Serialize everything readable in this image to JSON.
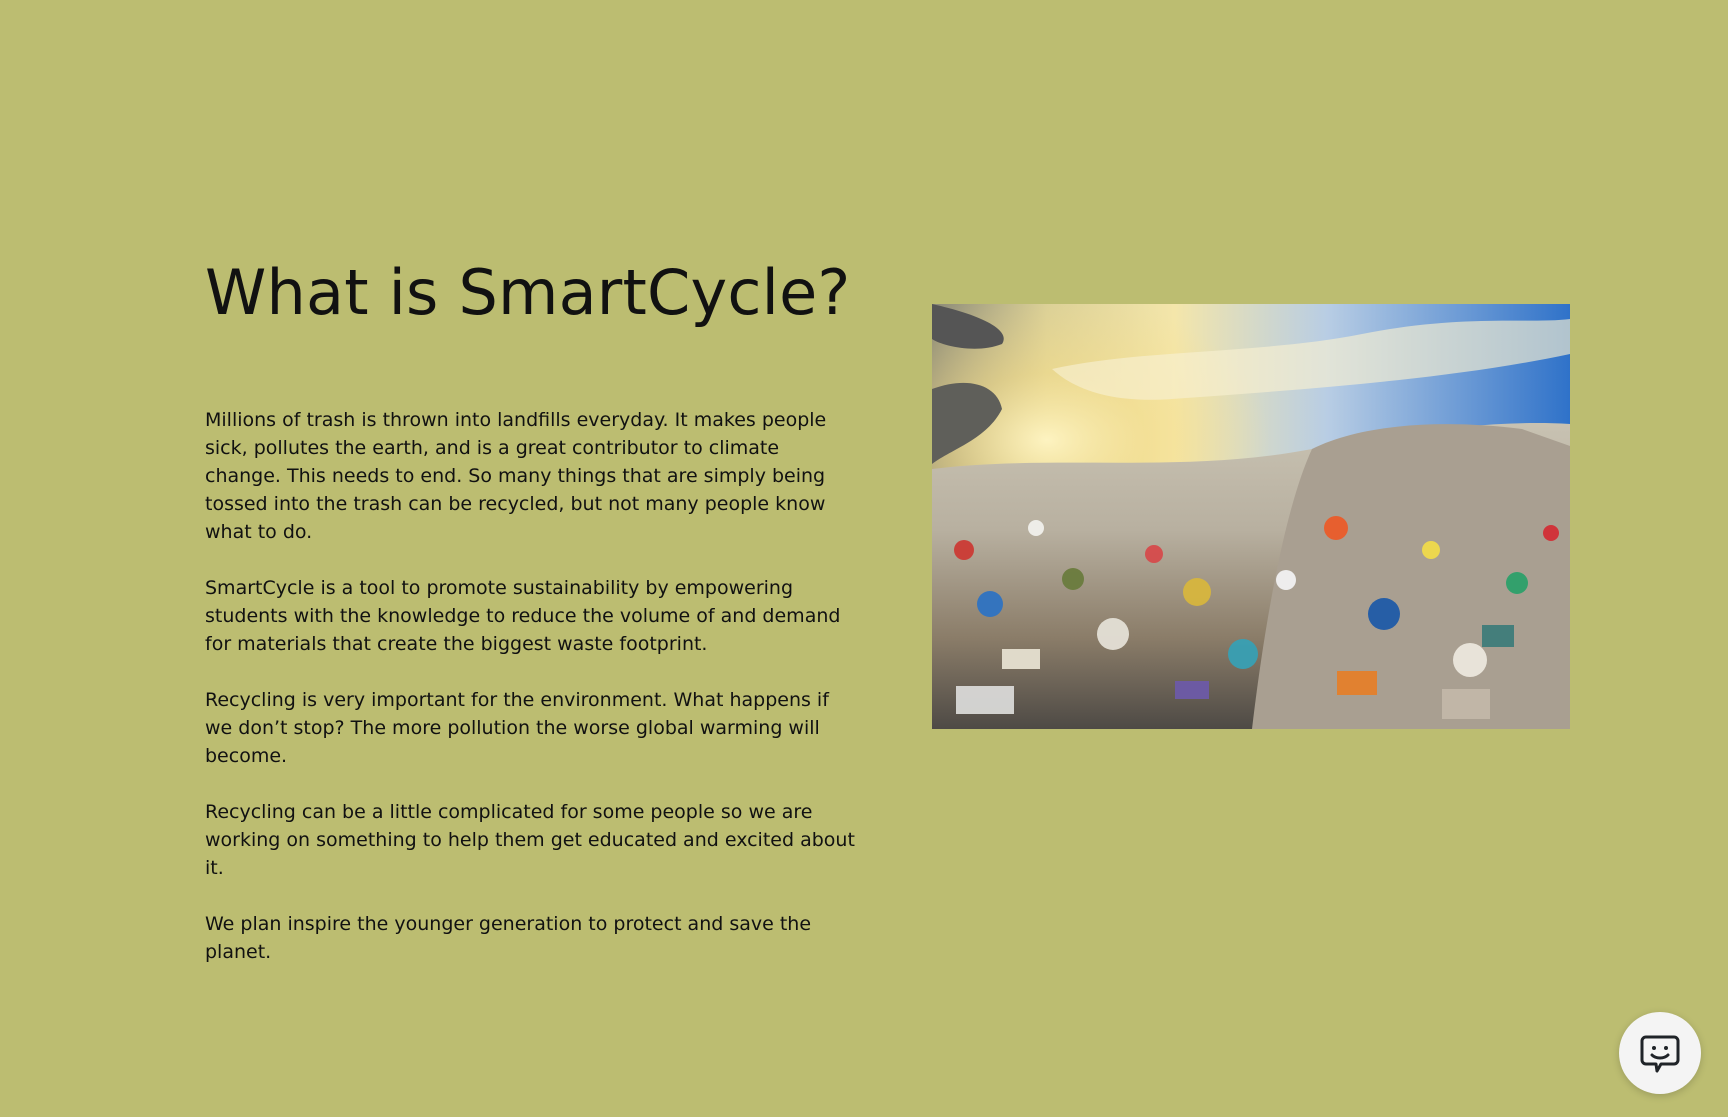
{
  "page": {
    "background_color": "#bcbd71"
  },
  "about": {
    "title": "What is SmartCycle?",
    "paragraphs": [
      "Millions of trash is thrown into landfills everyday. It makes people sick, pollutes the earth, and is a great contributor to climate change. This needs to end. So many things that are simply being tossed into the trash can be recycled, but not many people know what to do.",
      "SmartCycle is a tool to promote sustainability by empowering students with the knowledge to reduce the volume of and demand for materials that create the biggest waste footprint.",
      "Recycling is very important for the environment. What happens if we don’t stop? The more pollution the worse global warming will become.",
      "Recycling can be a little complicated for some people so we are working on something to help them get educated and excited about it.",
      "We plan inspire the younger generation to protect and save the planet."
    ],
    "image": {
      "icon": "landfill-image"
    }
  },
  "feedback_button": {
    "icon": "feedback-chat-icon"
  }
}
